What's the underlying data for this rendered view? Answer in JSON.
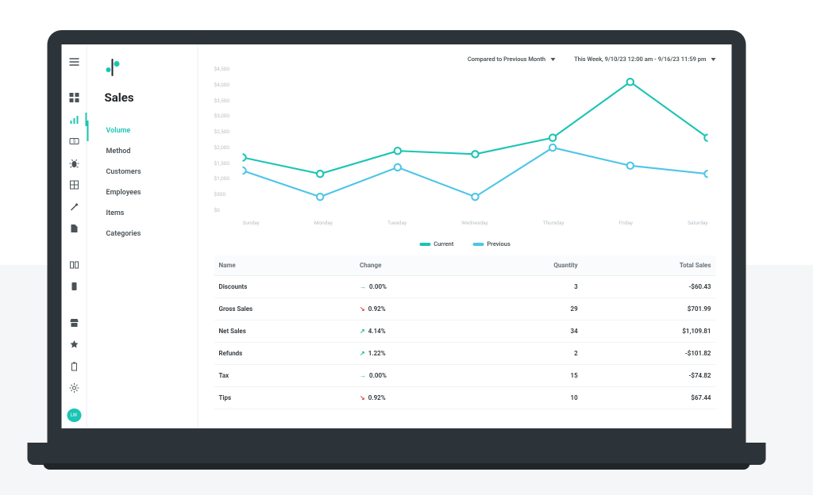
{
  "page": {
    "title": "Sales",
    "compare_label": "Compared to Previous Month",
    "range_label": "This Week, 9/10/23 12:00 am - 9/16/23 11:59 pm"
  },
  "avatar": {
    "initials": "LW"
  },
  "subnav": {
    "items": [
      {
        "label": "Volume",
        "active": true
      },
      {
        "label": "Method"
      },
      {
        "label": "Customers"
      },
      {
        "label": "Employees"
      },
      {
        "label": "Items"
      },
      {
        "label": "Categories"
      }
    ]
  },
  "chart_data": {
    "type": "line",
    "xlabel": "",
    "ylabel": "",
    "ylim": [
      0,
      4500
    ],
    "yticks": [
      "$0",
      "$500",
      "$1,000",
      "$1,500",
      "$2,000",
      "$2,500",
      "$3,000",
      "$3,500",
      "$4,000",
      "$4,500"
    ],
    "categories": [
      "Sunday",
      "Monday",
      "Tuesday",
      "Wednesday",
      "Thursday",
      "Friday",
      "Saturday"
    ],
    "series": [
      {
        "name": "Current",
        "color": "#1bc4b3",
        "values": [
          2000,
          1500,
          2200,
          2100,
          2600,
          4300,
          2600
        ]
      },
      {
        "name": "Previous",
        "color": "#4ec5e8",
        "values": [
          1600,
          800,
          1700,
          800,
          2300,
          1750,
          1500
        ]
      }
    ],
    "legend": {
      "current": "Current",
      "previous": "Previous"
    }
  },
  "table": {
    "headers": {
      "name": "Name",
      "change": "Change",
      "quantity": "Quantity",
      "total": "Total Sales"
    },
    "rows": [
      {
        "name": "Discounts",
        "dir": "flat",
        "change": "0.00%",
        "quantity": "3",
        "total": "-$60.43"
      },
      {
        "name": "Gross Sales",
        "dir": "down",
        "change": "0.92%",
        "quantity": "29",
        "total": "$701.99"
      },
      {
        "name": "Net Sales",
        "dir": "up",
        "change": "4.14%",
        "quantity": "34",
        "total": "$1,109.81"
      },
      {
        "name": "Refunds",
        "dir": "up",
        "change": "1.22%",
        "quantity": "2",
        "total": "-$101.82"
      },
      {
        "name": "Tax",
        "dir": "flat",
        "change": "0.00%",
        "quantity": "15",
        "total": "-$74.82"
      },
      {
        "name": "Tips",
        "dir": "down",
        "change": "0.92%",
        "quantity": "10",
        "total": "$67.44"
      }
    ]
  }
}
